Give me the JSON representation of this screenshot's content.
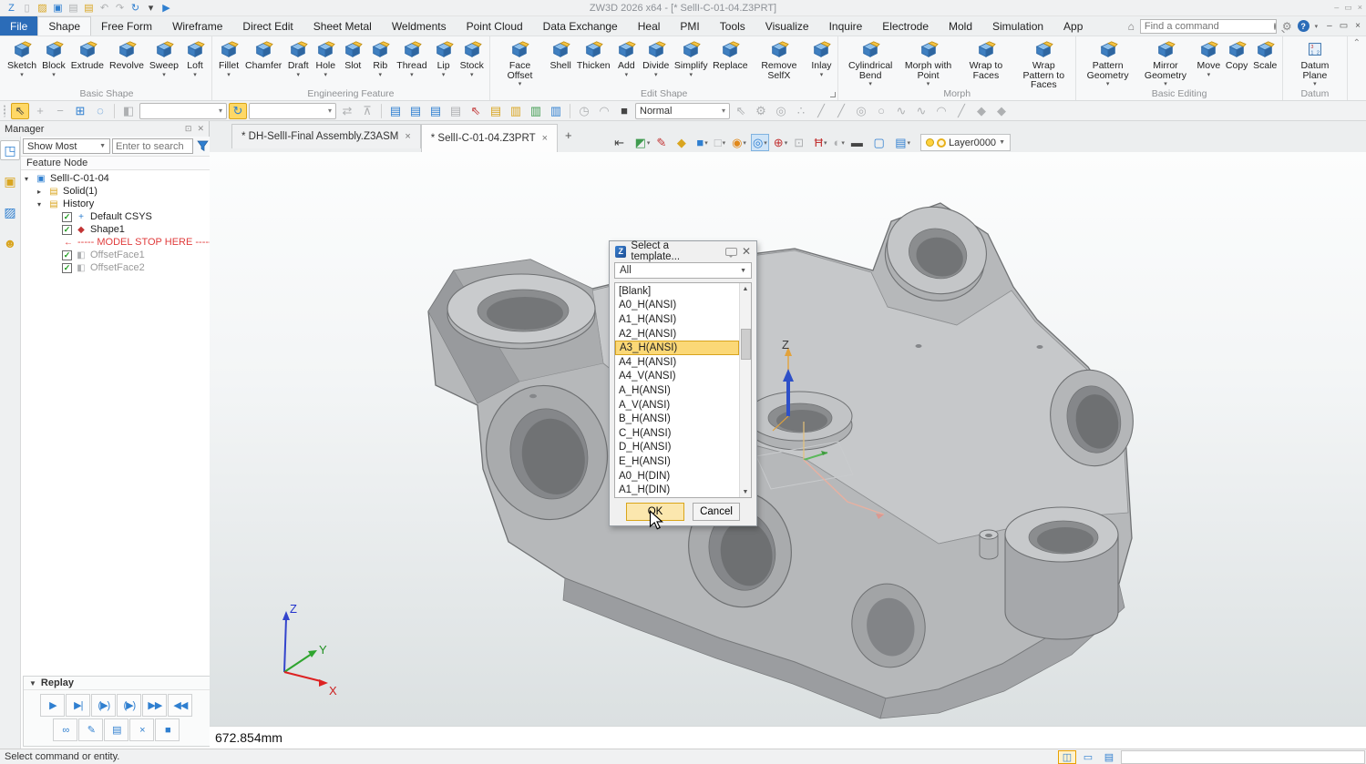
{
  "titlebar": {
    "title": "ZW3D 2026  x64  - [* SellI-C-01-04.Z3PRT]",
    "quick_icons": [
      {
        "name": "zw3d-logo-icon",
        "glyph": "Z",
        "tone": "blue"
      },
      {
        "name": "new-file-icon",
        "glyph": "▯",
        "tone": "gray"
      },
      {
        "name": "open-file-icon",
        "glyph": "▨",
        "tone": "yellow"
      },
      {
        "name": "save-icon",
        "glyph": "▣",
        "tone": "blue"
      },
      {
        "name": "print-icon",
        "glyph": "▤",
        "tone": "gray"
      },
      {
        "name": "batch-print-icon",
        "glyph": "▤",
        "tone": "yellow"
      },
      {
        "name": "undo-icon",
        "glyph": "↶",
        "tone": "gray"
      },
      {
        "name": "redo-icon",
        "glyph": "↷",
        "tone": "gray"
      },
      {
        "name": "regen-icon",
        "glyph": "↻",
        "tone": "blue"
      },
      {
        "name": "customize-icon",
        "glyph": "▾",
        "tone": "dark"
      },
      {
        "name": "expand-qat-icon",
        "glyph": "▶",
        "tone": "blue"
      }
    ],
    "window_controls": [
      {
        "name": "minimize-window-icon",
        "glyph": "–"
      },
      {
        "name": "restore-window-icon",
        "glyph": "▭"
      },
      {
        "name": "close-window-icon",
        "glyph": "×"
      }
    ]
  },
  "menubar": {
    "items": [
      {
        "name": "menu-file",
        "label": "File",
        "state": "file"
      },
      {
        "name": "menu-shape",
        "label": "Shape",
        "state": "active"
      },
      {
        "name": "menu-free-form",
        "label": "Free Form"
      },
      {
        "name": "menu-wireframe",
        "label": "Wireframe"
      },
      {
        "name": "menu-direct-edit",
        "label": "Direct Edit"
      },
      {
        "name": "menu-sheet-metal",
        "label": "Sheet Metal"
      },
      {
        "name": "menu-weldments",
        "label": "Weldments"
      },
      {
        "name": "menu-point-cloud",
        "label": "Point Cloud"
      },
      {
        "name": "menu-data-exchange",
        "label": "Data Exchange"
      },
      {
        "name": "menu-heal",
        "label": "Heal"
      },
      {
        "name": "menu-pmi",
        "label": "PMI"
      },
      {
        "name": "menu-tools",
        "label": "Tools"
      },
      {
        "name": "menu-visualize",
        "label": "Visualize"
      },
      {
        "name": "menu-inquire",
        "label": "Inquire"
      },
      {
        "name": "menu-electrode",
        "label": "Electrode"
      },
      {
        "name": "menu-mold",
        "label": "Mold"
      },
      {
        "name": "menu-simulation",
        "label": "Simulation"
      },
      {
        "name": "menu-app",
        "label": "App"
      }
    ],
    "search_placeholder": "Find a command",
    "mdi_controls": [
      {
        "name": "minimize-document-icon",
        "glyph": "–"
      },
      {
        "name": "restore-document-icon",
        "glyph": "▭"
      },
      {
        "name": "close-document-icon",
        "glyph": "×"
      }
    ]
  },
  "ribbon": {
    "groups": [
      {
        "label": "Basic Shape",
        "buttons": [
          {
            "name": "sketch-button",
            "label": "Sketch",
            "drop": true
          },
          {
            "name": "block-button",
            "label": "Block",
            "drop": true
          },
          {
            "name": "extrude-button",
            "label": "Extrude"
          },
          {
            "name": "revolve-button",
            "label": "Revolve"
          },
          {
            "name": "sweep-button",
            "label": "Sweep",
            "drop": true
          },
          {
            "name": "loft-button",
            "label": "Loft",
            "drop": true
          }
        ]
      },
      {
        "label": "Engineering Feature",
        "buttons": [
          {
            "name": "fillet-button",
            "label": "Fillet",
            "drop": true
          },
          {
            "name": "chamfer-button",
            "label": "Chamfer"
          },
          {
            "name": "draft-button",
            "label": "Draft",
            "drop": true
          },
          {
            "name": "hole-button",
            "label": "Hole",
            "drop": true
          },
          {
            "name": "slot-button",
            "label": "Slot"
          },
          {
            "name": "rib-button",
            "label": "Rib",
            "drop": true
          },
          {
            "name": "thread-button",
            "label": "Thread",
            "drop": true
          },
          {
            "name": "lip-button",
            "label": "Lip",
            "drop": true
          },
          {
            "name": "stock-button",
            "label": "Stock",
            "drop": true
          }
        ]
      },
      {
        "label": "Edit Shape",
        "buttons": [
          {
            "name": "face-offset-button",
            "label": "Face Offset",
            "drop": true
          },
          {
            "name": "shell-button",
            "label": "Shell"
          },
          {
            "name": "thicken-button",
            "label": "Thicken"
          },
          {
            "name": "add-button",
            "label": "Add",
            "drop": true
          },
          {
            "name": "divide-button",
            "label": "Divide",
            "drop": true
          },
          {
            "name": "simplify-button",
            "label": "Simplify",
            "drop": true
          },
          {
            "name": "replace-button",
            "label": "Replace"
          },
          {
            "name": "remove-selfx-button",
            "label": "Remove SelfX"
          },
          {
            "name": "inlay-button",
            "label": "Inlay",
            "drop": true
          }
        ]
      },
      {
        "label": "Morph",
        "buttons": [
          {
            "name": "cylindrical-bend-button",
            "label": "Cylindrical Bend",
            "drop": true
          },
          {
            "name": "morph-with-point-button",
            "label": "Morph with Point",
            "drop": true
          },
          {
            "name": "wrap-to-faces-button",
            "label": "Wrap to Faces"
          },
          {
            "name": "wrap-pattern-to-faces-button",
            "label": "Wrap Pattern to Faces"
          }
        ]
      },
      {
        "label": "Basic Editing",
        "buttons": [
          {
            "name": "pattern-geometry-button",
            "label": "Pattern Geometry",
            "drop": true
          },
          {
            "name": "mirror-geometry-button",
            "label": "Mirror Geometry",
            "drop": true
          },
          {
            "name": "move-button",
            "label": "Move",
            "drop": true
          },
          {
            "name": "copy-button",
            "label": "Copy"
          },
          {
            "name": "scale-button",
            "label": "Scale"
          }
        ]
      },
      {
        "label": "Datum",
        "buttons": [
          {
            "name": "datum-plane-button",
            "label": "Datum Plane",
            "drop": true
          }
        ]
      }
    ]
  },
  "toolbar2": {
    "items": [
      {
        "type": "grip",
        "name": "toolbar-grip"
      },
      {
        "type": "icon",
        "name": "pick-icon",
        "glyph": "⇖",
        "tone": "dark",
        "state": "selected"
      },
      {
        "type": "icon",
        "name": "pick-add-icon",
        "glyph": "+",
        "tone": "gray"
      },
      {
        "type": "icon",
        "name": "pick-remove-icon",
        "glyph": "−",
        "tone": "gray"
      },
      {
        "type": "icon",
        "name": "pick-window-icon",
        "glyph": "⊞",
        "tone": "blue"
      },
      {
        "type": "icon",
        "name": "pick-lasso-icon",
        "glyph": "◌",
        "tone": "blue"
      },
      {
        "type": "sep",
        "name": "separator"
      },
      {
        "type": "icon",
        "name": "pick-filter-icon",
        "glyph": "◧",
        "tone": "gray"
      },
      {
        "type": "combo",
        "name": "filter-combo",
        "value": ""
      },
      {
        "type": "icon",
        "name": "auto-regen-icon",
        "glyph": "↻",
        "tone": "blue",
        "state": "selected"
      },
      {
        "type": "combo",
        "name": "target-combo",
        "value": ""
      },
      {
        "type": "icon",
        "name": "align-icon",
        "glyph": "⇄",
        "tone": "gray"
      },
      {
        "type": "icon",
        "name": "lock-icon",
        "glyph": "⊼",
        "tone": "gray"
      },
      {
        "type": "sep",
        "name": "separator"
      },
      {
        "type": "icon",
        "name": "history-manager-icon",
        "glyph": "▤",
        "tone": "blue"
      },
      {
        "type": "icon",
        "name": "history-rollback-icon",
        "glyph": "▤",
        "tone": "blue"
      },
      {
        "type": "icon",
        "name": "history-insert-icon",
        "glyph": "▤",
        "tone": "blue"
      },
      {
        "type": "icon",
        "name": "history-skip-icon",
        "glyph": "▤",
        "tone": "gray"
      },
      {
        "type": "icon",
        "name": "redline-pick-icon",
        "glyph": "⇖",
        "tone": "red"
      },
      {
        "type": "icon",
        "name": "notes-list-icon",
        "glyph": "▤",
        "tone": "yellow"
      },
      {
        "type": "icon",
        "name": "export-folder-icon",
        "glyph": "▥",
        "tone": "yellow"
      },
      {
        "type": "icon",
        "name": "import-folder-icon",
        "glyph": "▥",
        "tone": "green"
      },
      {
        "type": "icon",
        "name": "session-folder-icon",
        "glyph": "▥",
        "tone": "blue"
      },
      {
        "type": "sep",
        "name": "separator"
      },
      {
        "type": "icon",
        "name": "timer-icon",
        "glyph": "◷",
        "tone": "gray"
      },
      {
        "type": "icon",
        "name": "loop-icon",
        "glyph": "◠",
        "tone": "gray"
      },
      {
        "type": "icon",
        "name": "stop-icon",
        "glyph": "■",
        "tone": "dark"
      },
      {
        "type": "combo",
        "name": "render-mode-combo",
        "value": "Normal"
      },
      {
        "type": "icon",
        "name": "pointer-icon",
        "glyph": "⇖",
        "tone": "gray"
      },
      {
        "type": "icon",
        "name": "drag-icon",
        "glyph": "⚙",
        "tone": "gray"
      },
      {
        "type": "icon",
        "name": "play-circle-icon",
        "glyph": "◎",
        "tone": "gray"
      },
      {
        "type": "icon",
        "name": "snap-dots-icon",
        "glyph": "∴",
        "tone": "gray"
      },
      {
        "type": "icon",
        "name": "line-tool-icon",
        "glyph": "╱",
        "tone": "gray"
      },
      {
        "type": "icon",
        "name": "polyline-tool-icon",
        "glyph": "╱",
        "tone": "gray"
      },
      {
        "type": "icon",
        "name": "circle-tool-icon",
        "glyph": "◎",
        "tone": "gray"
      },
      {
        "type": "icon",
        "name": "ellipse-tool-icon",
        "glyph": "○",
        "tone": "gray"
      },
      {
        "type": "icon",
        "name": "spline-tool-icon",
        "glyph": "∿",
        "tone": "gray"
      },
      {
        "type": "icon",
        "name": "curve-tool-icon",
        "glyph": "∿",
        "tone": "gray"
      },
      {
        "type": "icon",
        "name": "arc-tool-icon",
        "glyph": "◠",
        "tone": "gray"
      },
      {
        "type": "icon",
        "name": "segment-tool-icon",
        "glyph": "╱",
        "tone": "gray"
      },
      {
        "type": "icon",
        "name": "face-tool-icon",
        "glyph": "◆",
        "tone": "gray"
      },
      {
        "type": "icon",
        "name": "solid-tool-icon",
        "glyph": "◆",
        "tone": "gray"
      }
    ],
    "collapse_glyph": "⌃"
  },
  "tabs": {
    "items": [
      {
        "name": "document-tab",
        "label": "* DH-SellI-Final Assembly.Z3ASM",
        "close": "×"
      },
      {
        "name": "document-tab",
        "label": "* SellI-C-01-04.Z3PRT",
        "close": "×",
        "active": true
      }
    ],
    "add_label": "+"
  },
  "view_toolbar": {
    "items": [
      {
        "name": "exit-environment-icon",
        "glyph": "⇤",
        "tone": "dark"
      },
      {
        "name": "appearance-icon",
        "glyph": "◩",
        "tone": "green",
        "drop": true
      },
      {
        "name": "brush-icon",
        "glyph": "✎",
        "tone": "red"
      },
      {
        "name": "face-color-icon",
        "glyph": "◆",
        "tone": "yellow"
      },
      {
        "name": "shaded-display-icon",
        "glyph": "■",
        "tone": "blue",
        "drop": true
      },
      {
        "name": "wireframe-display-icon",
        "glyph": "□",
        "tone": "gray",
        "drop": true
      },
      {
        "name": "section-view-icon",
        "glyph": "◉",
        "tone": "orange",
        "drop": true
      },
      {
        "name": "silhouette-icon",
        "glyph": "◎",
        "tone": "blue",
        "drop": true,
        "state": "selected"
      },
      {
        "name": "view-orient-icon",
        "glyph": "⊕",
        "tone": "red",
        "drop": true
      },
      {
        "name": "zoom-window-icon",
        "glyph": "⊡",
        "tone": "gray"
      },
      {
        "name": "hatch-icon",
        "glyph": "Ħ",
        "tone": "red",
        "drop": true
      },
      {
        "name": "background-icon",
        "glyph": "◐",
        "tone": "gray",
        "drop": true
      },
      {
        "name": "edge-display-icon",
        "glyph": "▬",
        "tone": "dark"
      },
      {
        "name": "plane-display-icon",
        "glyph": "▢",
        "tone": "blue"
      },
      {
        "name": "multi-layer-icon",
        "glyph": "▤",
        "tone": "blue",
        "drop": true
      }
    ],
    "layer_value": "Layer0000"
  },
  "manager": {
    "title": "Manager",
    "filter_value": "Show Most",
    "search_placeholder": "Enter to search",
    "tree_header": "Feature Node",
    "side_icons": [
      {
        "name": "feature-manager-icon",
        "glyph": "◳",
        "tone": "blue",
        "state": "selected"
      },
      {
        "name": "visual-manager-icon",
        "glyph": "▣",
        "tone": "yellow"
      },
      {
        "name": "render-manager-icon",
        "glyph": "▨",
        "tone": "blue"
      },
      {
        "name": "role-manager-icon",
        "glyph": "☻",
        "tone": "yellow"
      }
    ],
    "tree": [
      {
        "name": "tree-item-root",
        "arrow": "▾",
        "icon_name": "part-icon",
        "icon_glyph": "▣",
        "icon_tone": "blue",
        "label": "SellI-C-01-04",
        "indent": 0
      },
      {
        "name": "tree-item-solid",
        "arrow": "▸",
        "icon_name": "solid-folder-icon",
        "icon_glyph": "▤",
        "icon_tone": "yellow",
        "label": "Solid(1)",
        "indent": 1
      },
      {
        "name": "tree-item-history",
        "arrow": "▾",
        "icon_name": "history-folder-icon",
        "icon_glyph": "▤",
        "icon_tone": "yellow",
        "label": "History",
        "indent": 1
      },
      {
        "name": "tree-item-default-csys",
        "icon_name": "csys-icon",
        "icon_glyph": "+",
        "icon_tone": "blue",
        "label": "Default CSYS",
        "checked": true,
        "indent": 2
      },
      {
        "name": "tree-item-shape1",
        "icon_name": "shape-icon",
        "icon_glyph": "◆",
        "icon_tone": "red",
        "label": "Shape1",
        "checked": true,
        "indent": 2
      },
      {
        "name": "tree-item-model-stop",
        "icon_name": "stop-arrow-icon",
        "icon_glyph": "←",
        "icon_tone": "red",
        "label": "----- MODEL STOP HERE -----",
        "variant": "stop",
        "indent": 2
      },
      {
        "name": "tree-item-offsetface1",
        "icon_name": "offset-face-icon",
        "icon_glyph": "◧",
        "icon_tone": "gray",
        "label": "OffsetFace1",
        "checked": true,
        "variant": "dim",
        "indent": 2
      },
      {
        "name": "tree-item-offsetface2",
        "icon_name": "offset-face-icon",
        "icon_glyph": "◧",
        "icon_tone": "gray",
        "label": "OffsetFace2",
        "checked": true,
        "variant": "dim",
        "indent": 2
      }
    ],
    "replay": {
      "title": "Replay",
      "row1": [
        {
          "name": "replay-play-icon",
          "glyph": "▶",
          "tone": "blue"
        },
        {
          "name": "replay-play-to-icon",
          "glyph": "▶|",
          "tone": "blue"
        },
        {
          "name": "replay-play-dialog-icon",
          "glyph": "(▶)",
          "tone": "blue"
        },
        {
          "name": "replay-play-span-icon",
          "glyph": "(▶)",
          "tone": "blue"
        },
        {
          "name": "replay-forward-icon",
          "glyph": "▶▶",
          "tone": "blue"
        },
        {
          "name": "replay-rewind-icon",
          "glyph": "◀◀",
          "tone": "blue"
        }
      ],
      "row2": [
        {
          "name": "replay-link-icon",
          "glyph": "∞",
          "tone": "blue"
        },
        {
          "name": "replay-edit-icon",
          "glyph": "✎",
          "tone": "yellow"
        },
        {
          "name": "replay-book-icon",
          "glyph": "▤",
          "tone": "yellow"
        },
        {
          "name": "replay-delete-icon",
          "glyph": "×",
          "tone": "red"
        },
        {
          "name": "replay-end-icon",
          "glyph": "■",
          "tone": "blue"
        }
      ]
    }
  },
  "viewport": {
    "axis_label": "Z",
    "triad": {
      "x": "X",
      "y": "Y",
      "z": "Z"
    },
    "readout": "672.854mm"
  },
  "dialog": {
    "title": "Select a template...",
    "filter_value": "All",
    "items": [
      {
        "label": "[Blank]"
      },
      {
        "label": "A0_H(ANSI)"
      },
      {
        "label": "A1_H(ANSI)"
      },
      {
        "label": "A2_H(ANSI)"
      },
      {
        "label": "A3_H(ANSI)",
        "selected": true
      },
      {
        "label": "A4_H(ANSI)"
      },
      {
        "label": "A4_V(ANSI)"
      },
      {
        "label": "A_H(ANSI)"
      },
      {
        "label": "A_V(ANSI)"
      },
      {
        "label": "B_H(ANSI)"
      },
      {
        "label": "C_H(ANSI)"
      },
      {
        "label": "D_H(ANSI)"
      },
      {
        "label": "E_H(ANSI)"
      },
      {
        "label": "A0_H(DIN)"
      },
      {
        "label": "A1_H(DIN)"
      }
    ],
    "ok": "OK",
    "cancel": "Cancel"
  },
  "statusbar": {
    "message": "Select command or entity.",
    "icons": [
      {
        "name": "prompt-toggle-icon",
        "glyph": "◫",
        "tone": "blue",
        "state": "selected"
      },
      {
        "name": "screen-display-icon",
        "glyph": "▭",
        "tone": "blue"
      },
      {
        "name": "task-list-icon",
        "glyph": "▤",
        "tone": "blue"
      }
    ]
  },
  "colors": {
    "accent_yellow": "#ffd866",
    "selection_orange": "#fbd877",
    "file_tab_blue": "#2b6cb8",
    "stop_red": "#e03c3c",
    "model_gray": "#b6b8ba"
  }
}
